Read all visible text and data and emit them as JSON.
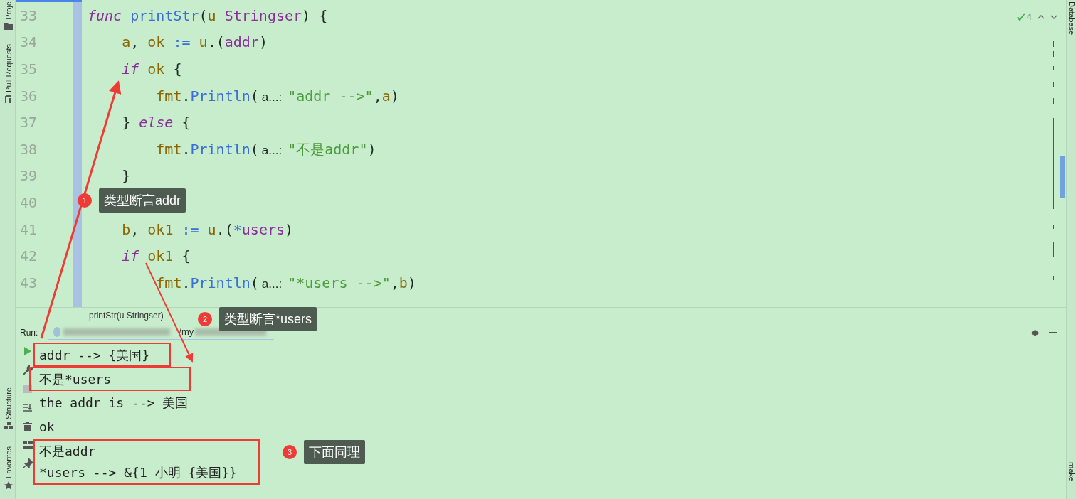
{
  "left_tool_strip": [
    {
      "label": "Proje",
      "kind": "folder"
    },
    {
      "label": "Pull Requests",
      "kind": "pull"
    },
    {
      "label": "Structure",
      "kind": "structure"
    },
    {
      "label": "Favorites",
      "kind": "star"
    }
  ],
  "right_tool_strip": [
    {
      "label": "Database",
      "kind": "top"
    },
    {
      "label": "make",
      "kind": "bottom"
    }
  ],
  "editor": {
    "inspection_count": "4",
    "lines": [
      {
        "number": "33",
        "tokens": [
          {
            "text": "func",
            "kind": "keyword"
          },
          {
            "text": " printStr",
            "kind": "function"
          },
          {
            "text": "(",
            "kind": "plain"
          },
          {
            "text": "u",
            "kind": "var"
          },
          {
            "text": " Stringser",
            "kind": "type"
          },
          {
            "text": ") {",
            "kind": "plain"
          }
        ]
      },
      {
        "number": "34",
        "tokens": [
          {
            "text": "    a",
            "kind": "var"
          },
          {
            "text": ", ",
            "kind": "plain"
          },
          {
            "text": "ok",
            "kind": "var"
          },
          {
            "text": " := ",
            "kind": "operator"
          },
          {
            "text": "u",
            "kind": "var"
          },
          {
            "text": ".(",
            "kind": "plain"
          },
          {
            "text": "addr",
            "kind": "type"
          },
          {
            "text": ")",
            "kind": "plain"
          }
        ]
      },
      {
        "number": "35",
        "tokens": [
          {
            "text": "    if",
            "kind": "keyword"
          },
          {
            "text": " ok",
            "kind": "var"
          },
          {
            "text": " {",
            "kind": "plain"
          }
        ]
      },
      {
        "number": "36",
        "tokens": [
          {
            "text": "        fmt",
            "kind": "var"
          },
          {
            "text": ".",
            "kind": "plain"
          },
          {
            "text": "Println",
            "kind": "function"
          },
          {
            "text": "(",
            "kind": "plain"
          },
          {
            "text": "a...:",
            "kind": "hint"
          },
          {
            "text": "\"addr -->\"",
            "kind": "string"
          },
          {
            "text": ",",
            "kind": "plain"
          },
          {
            "text": "a",
            "kind": "var"
          },
          {
            "text": ")",
            "kind": "plain"
          }
        ]
      },
      {
        "number": "37",
        "tokens": [
          {
            "text": "    } ",
            "kind": "plain"
          },
          {
            "text": "else",
            "kind": "keyword"
          },
          {
            "text": " {",
            "kind": "plain"
          }
        ]
      },
      {
        "number": "38",
        "tokens": [
          {
            "text": "        fmt",
            "kind": "var"
          },
          {
            "text": ".",
            "kind": "plain"
          },
          {
            "text": "Println",
            "kind": "function"
          },
          {
            "text": "(",
            "kind": "plain"
          },
          {
            "text": "a...:",
            "kind": "hint"
          },
          {
            "text": "\"不是addr\"",
            "kind": "string"
          },
          {
            "text": ")",
            "kind": "plain"
          }
        ]
      },
      {
        "number": "39",
        "tokens": [
          {
            "text": "    }",
            "kind": "plain"
          }
        ]
      },
      {
        "number": "40"
      },
      {
        "number": "41",
        "tokens": [
          {
            "text": "    b",
            "kind": "var"
          },
          {
            "text": ", ",
            "kind": "plain"
          },
          {
            "text": "ok1",
            "kind": "var"
          },
          {
            "text": " := ",
            "kind": "operator"
          },
          {
            "text": "u",
            "kind": "var"
          },
          {
            "text": ".(",
            "kind": "plain"
          },
          {
            "text": "*",
            "kind": "operator"
          },
          {
            "text": "users",
            "kind": "type"
          },
          {
            "text": ")",
            "kind": "plain"
          }
        ]
      },
      {
        "number": "42",
        "tokens": [
          {
            "text": "    if",
            "kind": "keyword"
          },
          {
            "text": " ok1",
            "kind": "var"
          },
          {
            "text": " {",
            "kind": "plain"
          }
        ]
      },
      {
        "number": "43",
        "tokens": [
          {
            "text": "        fmt",
            "kind": "var"
          },
          {
            "text": ".",
            "kind": "plain"
          },
          {
            "text": "Println",
            "kind": "function"
          },
          {
            "text": "(",
            "kind": "plain"
          },
          {
            "text": "a...:",
            "kind": "hint"
          },
          {
            "text": "\"*users -->\"",
            "kind": "string"
          },
          {
            "text": ",",
            "kind": "plain"
          },
          {
            "text": "b",
            "kind": "var"
          },
          {
            "text": ")",
            "kind": "plain"
          }
        ]
      }
    ]
  },
  "run_panel": {
    "breadcrumb": "printStr(u Stringser)",
    "label": "Run:",
    "tab_visible_text": "/my",
    "output_groups": [
      {
        "highlighted": true,
        "lines": [
          "addr --> {美国}"
        ]
      },
      {
        "highlighted": true,
        "lines": [
          "不是*users"
        ]
      },
      {
        "highlighted": false,
        "lines": [
          "the addr is --> 美国",
          "ok"
        ]
      },
      {
        "highlighted": true,
        "lines": [
          "不是addr",
          "*users --> &{1 小明 {美国}}"
        ]
      }
    ]
  },
  "annotations": [
    {
      "number": "1",
      "text": "类型断言addr"
    },
    {
      "number": "2",
      "text": "类型断言*users"
    },
    {
      "number": "3",
      "text": "下面同理"
    }
  ]
}
